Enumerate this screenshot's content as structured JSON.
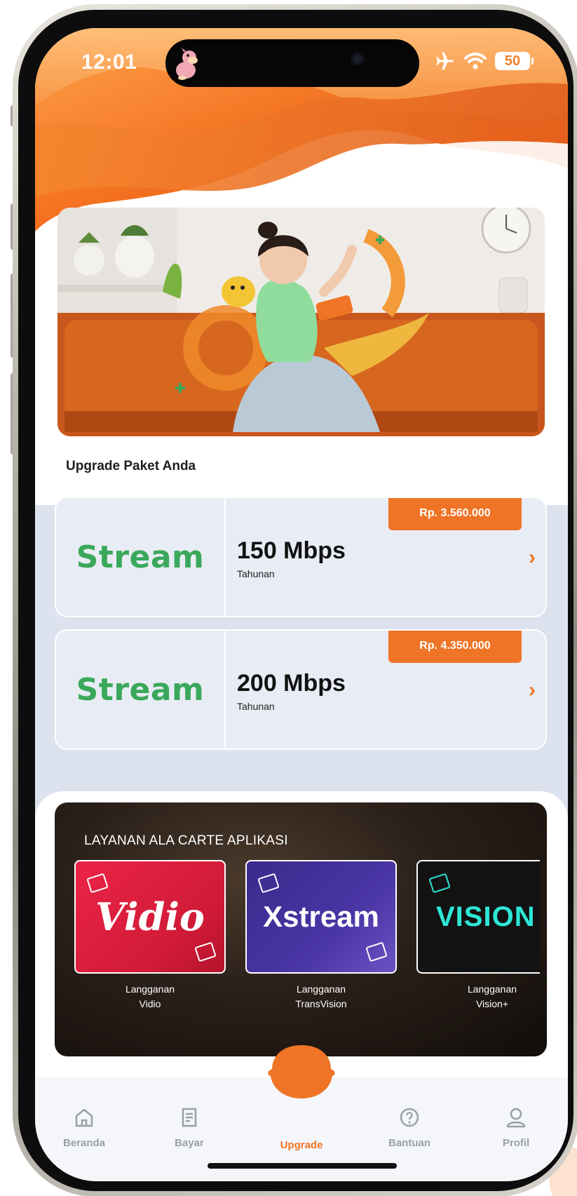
{
  "status_bar": {
    "time": "12:01",
    "battery": "50"
  },
  "upgrade_section": {
    "title": "Upgrade Paket Anda"
  },
  "packages": [
    {
      "brand": "Stream",
      "speed": "150 Mbps",
      "period": "Tahunan",
      "price": "Rp. 3.560.000"
    },
    {
      "brand": "Stream",
      "speed": "200 Mbps",
      "period": "Tahunan",
      "price": "Rp. 4.350.000"
    }
  ],
  "alacarte": {
    "title": "LAYANAN ALA CARTE APLIKASI",
    "apps": [
      {
        "logo": "Vidio",
        "caption_line1": "Langganan",
        "caption_line2": "Vidio",
        "color": "#e8203e"
      },
      {
        "logo": "Xstream",
        "caption_line1": "Langganan",
        "caption_line2": "TransVision",
        "color": "#3d2c8f"
      },
      {
        "logo": "VISION",
        "caption_line1": "Langganan",
        "caption_line2": "Vision+",
        "color": "#111111"
      }
    ]
  },
  "nav": {
    "items": [
      {
        "label": "Beranda",
        "icon": "home-icon"
      },
      {
        "label": "Bayar",
        "icon": "bill-icon"
      },
      {
        "label": "Upgrade",
        "icon": "upgrade-icon",
        "active": true
      },
      {
        "label": "Bantuan",
        "icon": "help-icon"
      },
      {
        "label": "Profil",
        "icon": "profile-icon"
      }
    ]
  },
  "colors": {
    "accent": "#ef7426",
    "stream_green": "#3aa85a",
    "inactive_nav": "#9aa0a8"
  }
}
